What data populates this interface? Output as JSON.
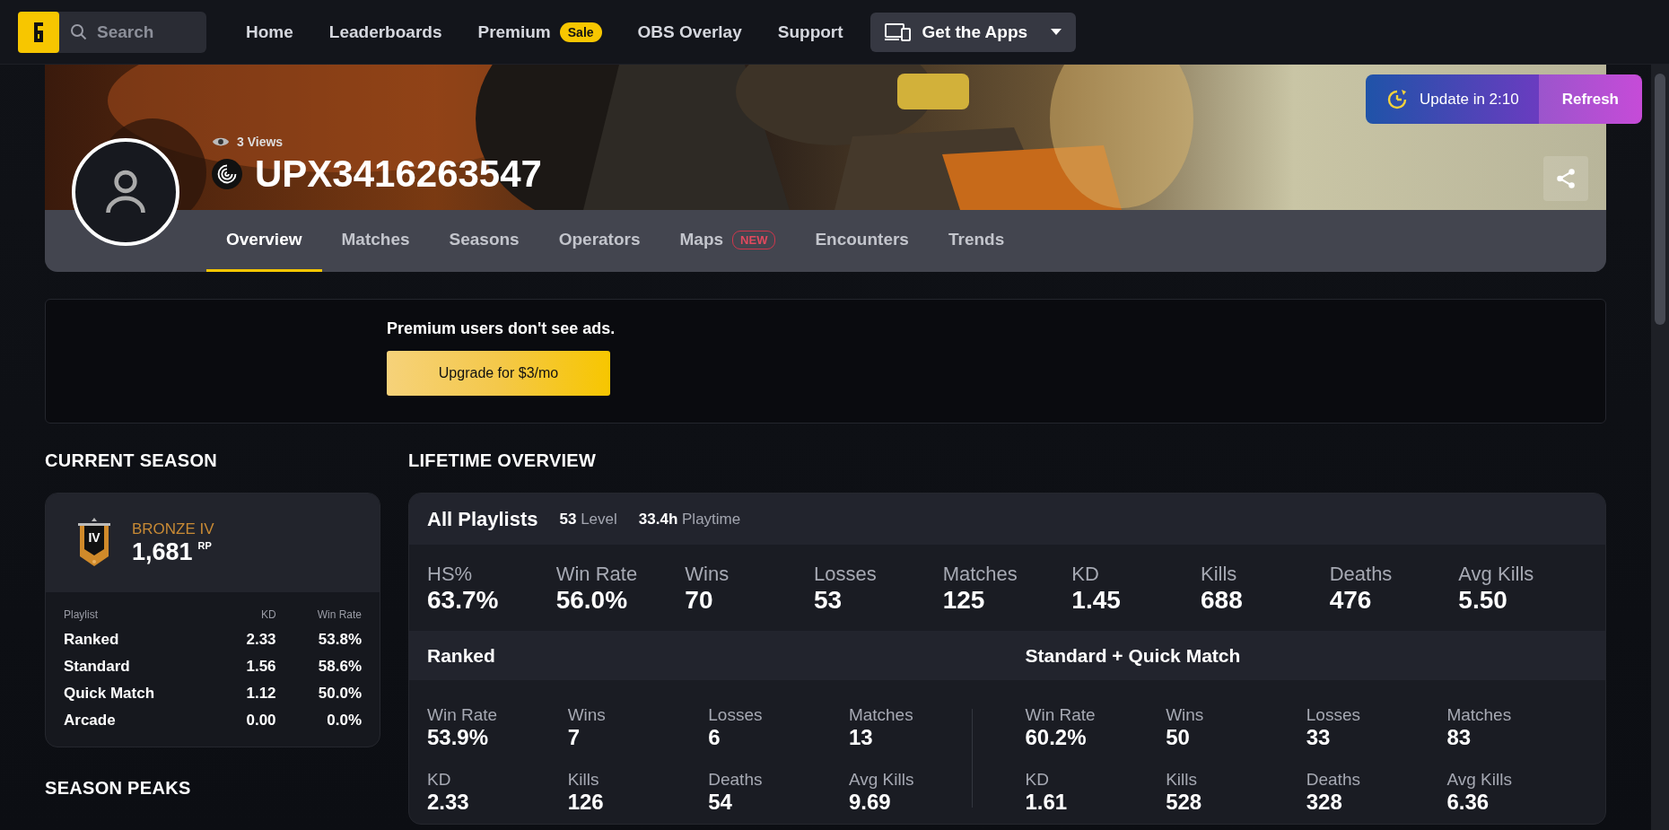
{
  "nav": {
    "search": {
      "placeholder": "Search"
    },
    "links": [
      {
        "label": "Home"
      },
      {
        "label": "Leaderboards"
      },
      {
        "label": "Premium",
        "badge": "Sale"
      },
      {
        "label": "OBS Overlay"
      },
      {
        "label": "Support"
      }
    ],
    "apps_button": "Get the Apps"
  },
  "profile": {
    "views": "3 Views",
    "name": "UPX3416263547",
    "update": "Update in 2:10",
    "refresh": "Refresh",
    "tabs": [
      {
        "label": "Overview",
        "selected": true
      },
      {
        "label": "Matches",
        "selected": false
      },
      {
        "label": "Seasons",
        "selected": false
      },
      {
        "label": "Operators",
        "selected": false
      },
      {
        "label": "Maps",
        "selected": false,
        "badge": "NEW"
      },
      {
        "label": "Encounters",
        "selected": false
      },
      {
        "label": "Trends",
        "selected": false
      }
    ]
  },
  "ad": {
    "text": "Premium users don't see ads.",
    "button": "Upgrade for $3/mo"
  },
  "current_season": {
    "title": "CURRENT SEASON",
    "rank": "BRONZE IV",
    "rank_badge": "IV",
    "rp": "1,681",
    "rp_unit": "RP",
    "columns": [
      "Playlist",
      "KD",
      "Win Rate"
    ],
    "rows": [
      [
        "Ranked",
        "2.33",
        "53.8%"
      ],
      [
        "Standard",
        "1.56",
        "58.6%"
      ],
      [
        "Quick Match",
        "1.12",
        "50.0%"
      ],
      [
        "Arcade",
        "0.00",
        "0.0%"
      ]
    ]
  },
  "season_peaks": {
    "title": "SEASON PEAKS"
  },
  "lifetime": {
    "title": "LIFETIME OVERVIEW",
    "all_playlists": {
      "title": "All Playlists",
      "level_value": "53",
      "level_label": "Level",
      "playtime_value": "33.4h",
      "playtime_label": "Playtime",
      "stats": [
        {
          "label": "HS%",
          "value": "63.7%"
        },
        {
          "label": "Win Rate",
          "value": "56.0%"
        },
        {
          "label": "Wins",
          "value": "70"
        },
        {
          "label": "Losses",
          "value": "53"
        },
        {
          "label": "Matches",
          "value": "125"
        },
        {
          "label": "KD",
          "value": "1.45"
        },
        {
          "label": "Kills",
          "value": "688"
        },
        {
          "label": "Deaths",
          "value": "476"
        },
        {
          "label": "Avg Kills",
          "value": "5.50"
        }
      ]
    },
    "groups": [
      {
        "title": "Ranked",
        "stats": [
          {
            "label": "Win Rate",
            "value": "53.9%"
          },
          {
            "label": "Wins",
            "value": "7"
          },
          {
            "label": "Losses",
            "value": "6"
          },
          {
            "label": "Matches",
            "value": "13"
          },
          {
            "label": "KD",
            "value": "2.33"
          },
          {
            "label": "Kills",
            "value": "126"
          },
          {
            "label": "Deaths",
            "value": "54"
          },
          {
            "label": "Avg Kills",
            "value": "9.69"
          }
        ]
      },
      {
        "title": "Standard + Quick Match",
        "stats": [
          {
            "label": "Win Rate",
            "value": "60.2%"
          },
          {
            "label": "Wins",
            "value": "50"
          },
          {
            "label": "Losses",
            "value": "33"
          },
          {
            "label": "Matches",
            "value": "83"
          },
          {
            "label": "KD",
            "value": "1.61"
          },
          {
            "label": "Kills",
            "value": "528"
          },
          {
            "label": "Deaths",
            "value": "328"
          },
          {
            "label": "Avg Kills",
            "value": "6.36"
          }
        ]
      }
    ]
  }
}
